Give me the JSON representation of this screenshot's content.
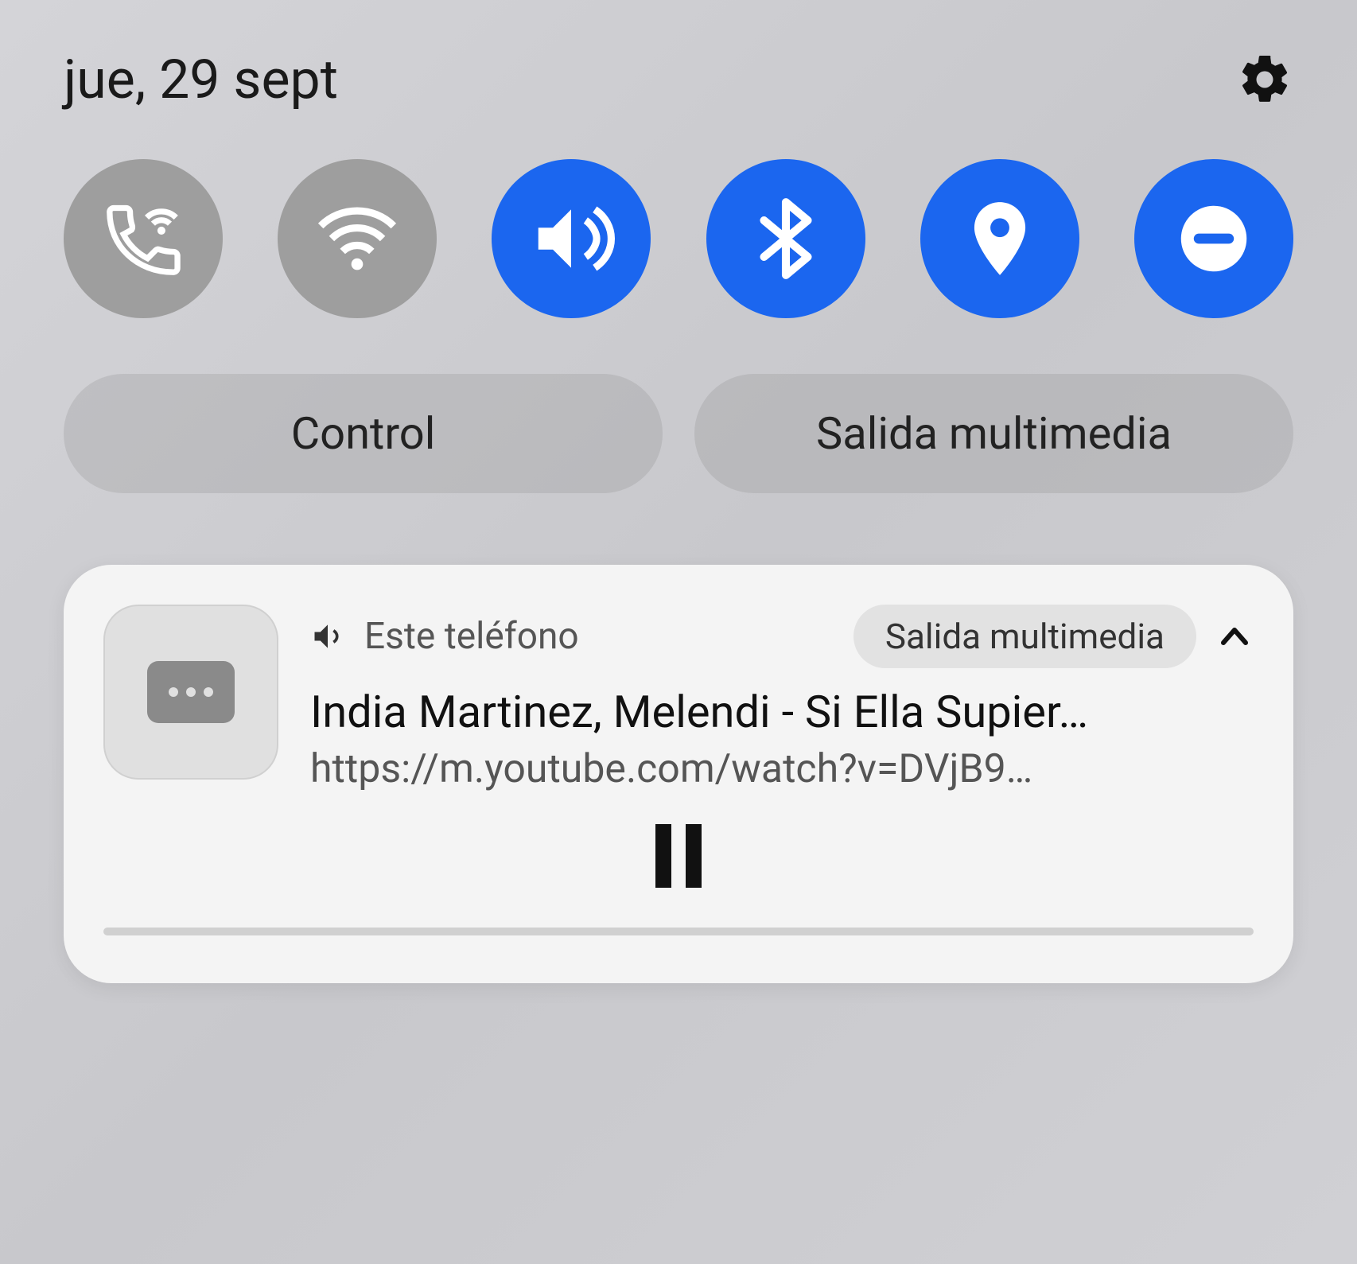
{
  "header": {
    "date": "jue, 29 sept",
    "toggles": [
      {
        "name": "wifi-calling",
        "active": false,
        "icon": "wifi-calling-icon"
      },
      {
        "name": "wifi",
        "active": false,
        "icon": "wifi-icon"
      },
      {
        "name": "sound",
        "active": true,
        "icon": "sound-icon"
      },
      {
        "name": "bluetooth",
        "active": true,
        "icon": "bluetooth-icon"
      },
      {
        "name": "location",
        "active": true,
        "icon": "location-icon"
      },
      {
        "name": "dnd",
        "active": true,
        "icon": "dnd-icon"
      }
    ],
    "pills": {
      "control": "Control",
      "media_output": "Salida multimedia"
    }
  },
  "media": {
    "output_device": "Este teléfono",
    "chip_label": "Salida multimedia",
    "title": "India Martinez, Melendi - Si Ella Supier…",
    "url": "https://m.youtube.com/watch?v=DVjB9…",
    "playing": true
  },
  "colors": {
    "toggle_on": "#1b66ef",
    "toggle_off": "#9e9e9e",
    "card_bg": "#f4f4f4"
  }
}
